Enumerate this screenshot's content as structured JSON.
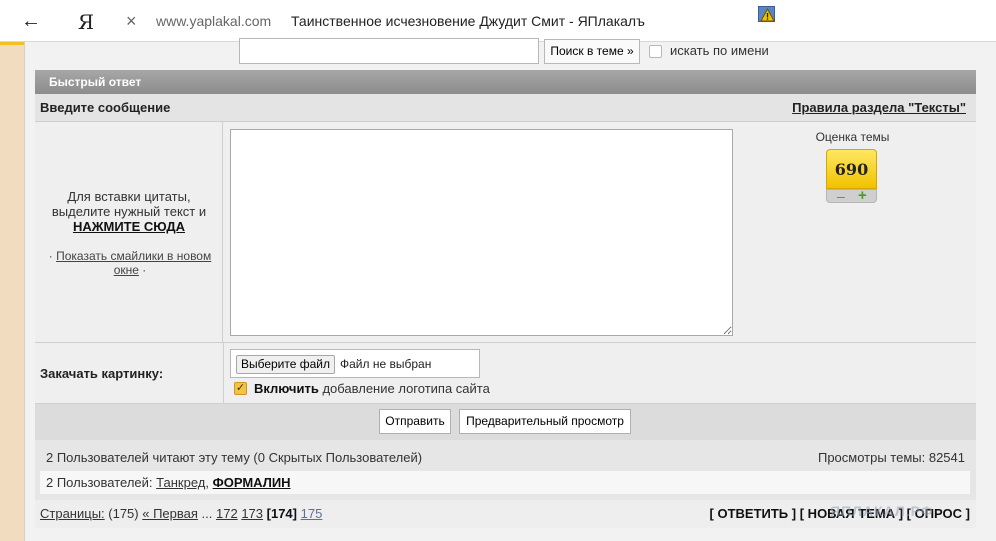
{
  "browser": {
    "back_icon": "arrow-left-icon",
    "logo": "Я",
    "close_icon": "close-icon",
    "domain": "www.yaplakal.com",
    "title": "Таинственное исчезновение Джудит Смит - ЯПлакалъ"
  },
  "search": {
    "button_label": "Поиск в теме »",
    "by_name_label": "искать по имени"
  },
  "quick_reply": {
    "header": "Быстрый ответ",
    "enter_message": "Введите сообщение",
    "rules_link": "Правила раздела \"Тексты\"",
    "quote_hint_lines": [
      "Для вставки цитаты,",
      "выделите нужный текст и"
    ],
    "quote_hint_action": "НАЖМИТЕ СЮДА",
    "smilies_prefix": "·",
    "smilies_link": "Показать смайлики в новом окне",
    "smilies_suffix": "·"
  },
  "rating": {
    "title": "Оценка темы",
    "value": "690",
    "minus": "–",
    "plus": "+"
  },
  "upload": {
    "label": "Закачать картинку:",
    "choose_button": "Выберите файл",
    "file_status": "Файл не выбран",
    "logo_checkbox_bold": "Включить",
    "logo_checkbox_rest": " добавление логотипа сайта",
    "logo_checked": true
  },
  "actions": {
    "send": "Отправить",
    "preview": "Предварительный просмотр"
  },
  "readers": {
    "summary": "2 Пользователей читают эту тему (0 Скрытых Пользователей)",
    "views": "Просмотры темы: 82541",
    "users_prefix": "2 Пользователей: ",
    "user1": "Танкред",
    "separator": ", ",
    "user2": "ФОРМАЛИН"
  },
  "pager": {
    "label": "Страницы:",
    "total": " (175) ",
    "first": "« Первая",
    "ellipsis": " ... ",
    "pages": [
      "172",
      "173"
    ],
    "current": "[174]",
    "next": "175"
  },
  "topic_actions": {
    "reply": "[ ОТВЕТИТЬ ]",
    "new_topic": "[ НОВАЯ ТЕМА ]",
    "poll": "[ ОПРОС ]"
  },
  "watermark": "ЯПЛАКАЛ.РФ"
}
